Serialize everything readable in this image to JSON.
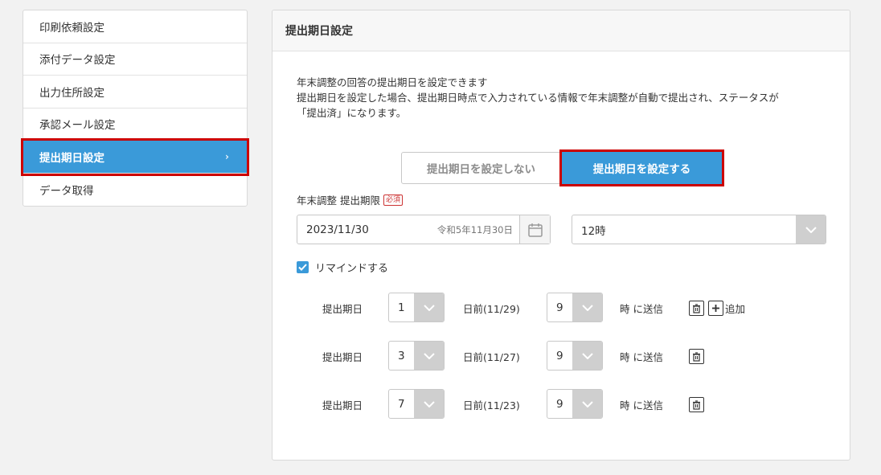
{
  "sidebar": {
    "items": [
      {
        "label": "印刷依頼設定"
      },
      {
        "label": "添付データ設定"
      },
      {
        "label": "出力住所設定"
      },
      {
        "label": "承認メール設定"
      },
      {
        "label": "提出期日設定",
        "chevron": "›"
      },
      {
        "label": "データ取得"
      }
    ]
  },
  "panel": {
    "title": "提出期日設定",
    "desc_line1": "年末調整の回答の提出期日を設定できます",
    "desc_line2": "提出期日を設定した場合、提出期日時点で入力されている情報で年末調整が自動で提出され、ステータスが",
    "desc_line3": "「提出済」になります。",
    "toggle_off": "提出期日を設定しない",
    "toggle_on": "提出期日を設定する",
    "deadline_label": "年末調整 提出期限",
    "required_badge": "必須",
    "date_value": "2023/11/30",
    "date_wareki": "令和5年11月30日",
    "hour_value": "12時",
    "remind_label": "リマインドする",
    "add_label": "追加"
  },
  "reminders": [
    {
      "prefix": "提出期日",
      "days": "1",
      "date_text": "日前(11/29)",
      "hour": "9",
      "suffix": "時 に送信"
    },
    {
      "prefix": "提出期日",
      "days": "3",
      "date_text": "日前(11/27)",
      "hour": "9",
      "suffix": "時 に送信"
    },
    {
      "prefix": "提出期日",
      "days": "7",
      "date_text": "日前(11/23)",
      "hour": "9",
      "suffix": "時 に送信"
    }
  ],
  "colors": {
    "accent": "#3a9ad9",
    "highlight": "#cc0000"
  },
  "icons": {
    "calendar": "calendar-icon",
    "trash": "trash-icon",
    "plus": "plus-icon",
    "chevron": "chevron-down-icon",
    "check": "check-icon"
  }
}
